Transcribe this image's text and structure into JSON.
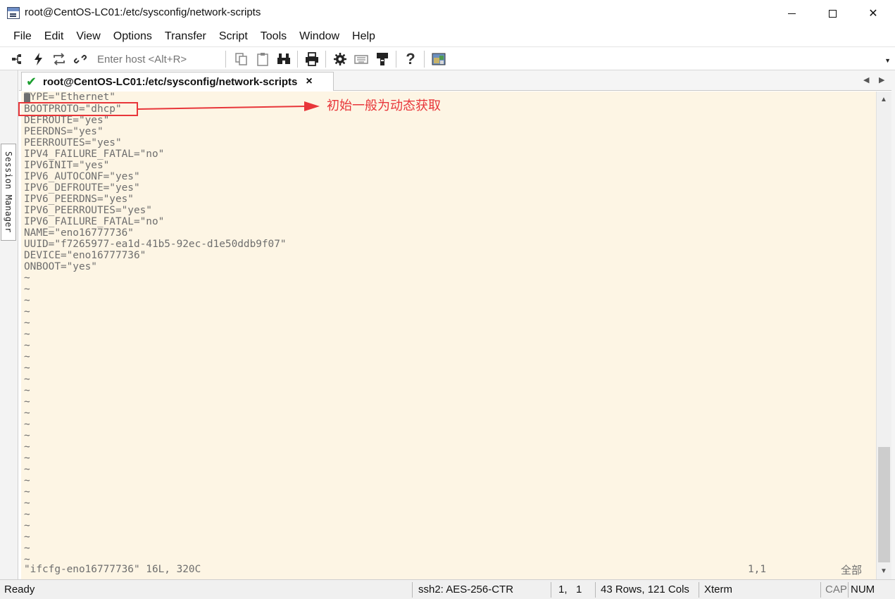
{
  "window": {
    "title": "root@CentOS-LC01:/etc/sysconfig/network-scripts",
    "controls": {
      "minimize": "minimize",
      "maximize": "maximize",
      "close": "✕"
    }
  },
  "menu": [
    "File",
    "Edit",
    "View",
    "Options",
    "Transfer",
    "Script",
    "Tools",
    "Window",
    "Help"
  ],
  "toolbar": {
    "host_placeholder": "Enter host <Alt+R>",
    "icons": [
      "connect-icon",
      "quick-connect-icon",
      "reconnect-icon",
      "disconnect-icon",
      "copy-icon",
      "paste-icon",
      "find-icon",
      "print-icon",
      "settings-icon",
      "keymap-icon",
      "sftp-icon",
      "help-icon",
      "map-icon"
    ]
  },
  "session_manager": {
    "label": "Session Manager"
  },
  "tab": {
    "label": "root@CentOS-LC01:/etc/sysconfig/network-scripts",
    "close": "×"
  },
  "terminal": {
    "lines": [
      "TYPE=\"Ethernet\"",
      "BOOTPROTO=\"dhcp\"",
      "DEFROUTE=\"yes\"",
      "PEERDNS=\"yes\"",
      "PEERROUTES=\"yes\"",
      "IPV4_FAILURE_FATAL=\"no\"",
      "IPV6INIT=\"yes\"",
      "IPV6_AUTOCONF=\"yes\"",
      "IPV6_DEFROUTE=\"yes\"",
      "IPV6_PEERDNS=\"yes\"",
      "IPV6_PEERROUTES=\"yes\"",
      "IPV6_FAILURE_FATAL=\"no\"",
      "NAME=\"eno16777736\"",
      "UUID=\"f7265977-ea1d-41b5-92ec-d1e50ddb9f07\"",
      "DEVICE=\"eno16777736\"",
      "ONBOOT=\"yes\""
    ],
    "empty_marker": "~",
    "empty_line_count": 26,
    "status_file": "\"ifcfg-eno16777736\" 16L, 320C",
    "status_position": "1,1",
    "status_scope": "全部",
    "background": "#fdf5e4",
    "text_color": "#6e6e6e"
  },
  "annotation": {
    "text": "初始一般为动态获取",
    "color": "#e8363a"
  },
  "statusbar": {
    "ready": "Ready",
    "cipher": "ssh2: AES-256-CTR",
    "cursor": "1,   1",
    "size": "43 Rows, 121 Cols",
    "term": "Xterm",
    "cap": "CAP",
    "num": "NUM"
  }
}
